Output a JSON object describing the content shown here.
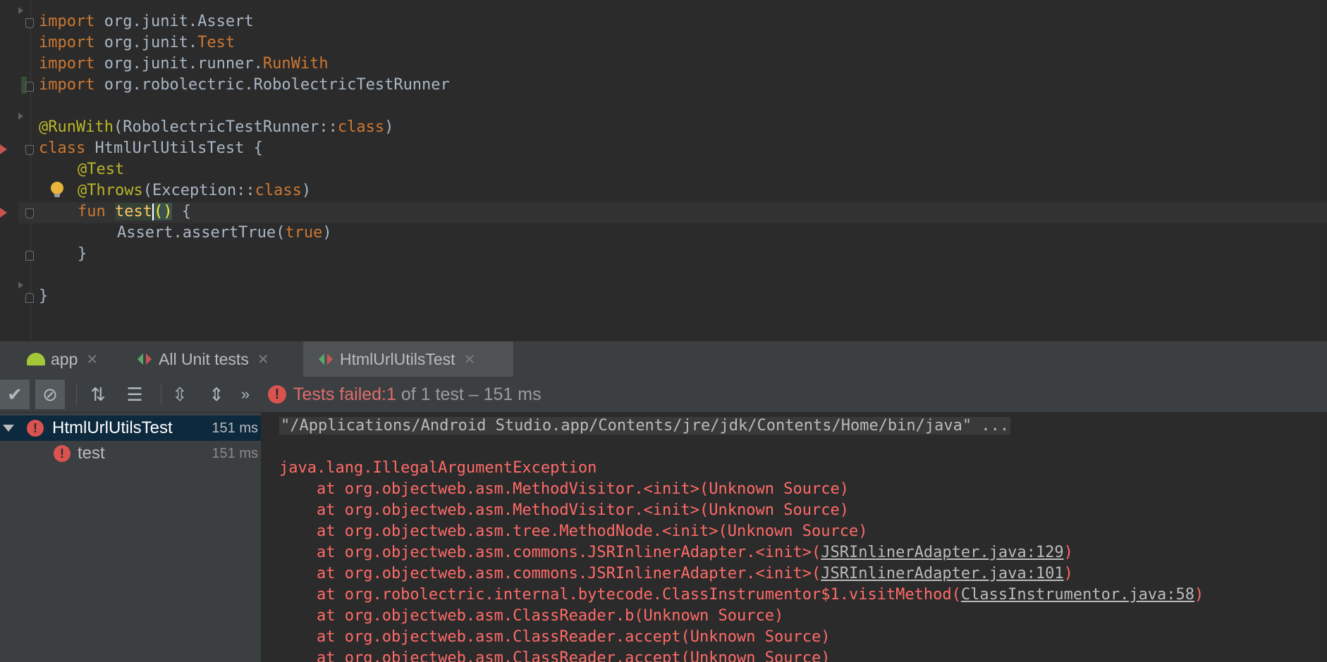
{
  "editor": {
    "lines": [
      {
        "kw": "import ",
        "rest": "org.junit.Assert",
        "hl": ""
      },
      {
        "kw": "import ",
        "rest": "org.junit.",
        "hl": "Test"
      },
      {
        "kw": "import ",
        "rest": "org.junit.runner.",
        "hl": "RunWith"
      },
      {
        "kw": "import ",
        "rest": "org.robolectric.RobolectricTestRunner",
        "hl": ""
      }
    ],
    "annotation_runwith": "@RunWith",
    "runwith_arg": "(RobolectricTestRunner::",
    "class_kw": "class",
    "runwith_close": ")",
    "class_decl_kw": "class ",
    "class_name": "HtmlUrlUtilsTest {",
    "test_annotation": "@Test",
    "throws_annotation": "@Throws",
    "throws_arg": "(Exception::",
    "throws_close": ")",
    "fun_kw": "fun ",
    "fun_name": "test",
    "fun_parens": "()",
    "fun_open": " {",
    "assert_call": "Assert.assertTrue(",
    "assert_arg": "true",
    "assert_close": ")",
    "close_brace_inner": "}",
    "close_brace_outer": "}"
  },
  "tabs": [
    {
      "label": "app",
      "icon": "android-icon"
    },
    {
      "label": "All Unit tests",
      "icon": "run-tests-icon"
    },
    {
      "label": "HtmlUrlUtilsTest",
      "icon": "run-tests-icon"
    }
  ],
  "status": {
    "prefix": "Tests failed: ",
    "failed_count": "1",
    "suffix": " of 1 test – 151 ms"
  },
  "tree": {
    "root": {
      "label": "HtmlUrlUtilsTest",
      "time": "151 ms"
    },
    "child": {
      "label": "test",
      "time": "151 ms"
    }
  },
  "console": {
    "command": "\"/Applications/Android Studio.app/Contents/jre/jdk/Contents/Home/bin/java\" ...",
    "exception": "java.lang.IllegalArgumentException",
    "stack": [
      {
        "text": "    at org.objectweb.asm.MethodVisitor.<init>(Unknown Source)",
        "link": "",
        "after": ""
      },
      {
        "text": "    at org.objectweb.asm.MethodVisitor.<init>(Unknown Source)",
        "link": "",
        "after": ""
      },
      {
        "text": "    at org.objectweb.asm.tree.MethodNode.<init>(Unknown Source)",
        "link": "",
        "after": ""
      },
      {
        "text": "    at org.objectweb.asm.commons.JSRInlinerAdapter.<init>(",
        "link": "JSRInlinerAdapter.java:129",
        "after": ")"
      },
      {
        "text": "    at org.objectweb.asm.commons.JSRInlinerAdapter.<init>(",
        "link": "JSRInlinerAdapter.java:101",
        "after": ")"
      },
      {
        "text": "    at org.robolectric.internal.bytecode.ClassInstrumentor$1.visitMethod(",
        "link": "ClassInstrumentor.java:58",
        "after": ")"
      },
      {
        "text": "    at org.objectweb.asm.ClassReader.b(Unknown Source)",
        "link": "",
        "after": ""
      },
      {
        "text": "    at org.objectweb.asm.ClassReader.accept(Unknown Source)",
        "link": "",
        "after": ""
      },
      {
        "text": "    at org.objectweb.asm.ClassReader.accept(Unknown Source)",
        "link": "",
        "after": ""
      }
    ]
  }
}
